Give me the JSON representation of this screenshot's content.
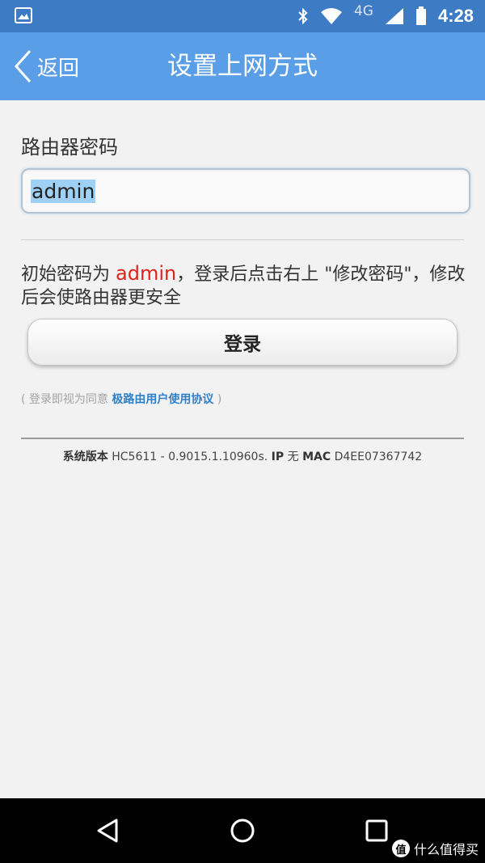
{
  "status_bar": {
    "network": "4G",
    "time": "4:28",
    "icons": [
      "gallery-icon",
      "bluetooth-icon",
      "wifi-icon",
      "signal-icon",
      "battery-icon"
    ]
  },
  "header": {
    "back_label": "返回",
    "title": "设置上网方式"
  },
  "form": {
    "password_label": "路由器密码",
    "password_value": "admin",
    "hint_prefix": "初始密码为 ",
    "hint_password": "admin",
    "hint_suffix": "，登录后点击右上 \"修改密码\"，修改后会使路由器更安全",
    "login_button": "登录"
  },
  "agreement": {
    "open_paren": "(",
    "prefix": " 登录即视为同意 ",
    "link": "极路由用户使用协议",
    "close_paren": " )"
  },
  "system_info": {
    "version_label": "系统版本",
    "version_value": "HC5611 - 0.9015.1.10960s.",
    "ip_label": "IP",
    "ip_value": "无",
    "mac_label": "MAC",
    "mac_value": "D4EE07367742"
  },
  "nav_bar": {
    "buttons": [
      "back-triangle-icon",
      "home-circle-icon",
      "recents-square-icon"
    ]
  },
  "watermark": {
    "badge": "值",
    "text": "什么值得买"
  },
  "colors": {
    "status_bar": "#3d7cc4",
    "title_bar": "#5a9ee7",
    "background": "#f2f2f2",
    "highlight_red": "#e1231b",
    "link_blue": "#2d7fca",
    "selection": "#9fd0f5"
  }
}
